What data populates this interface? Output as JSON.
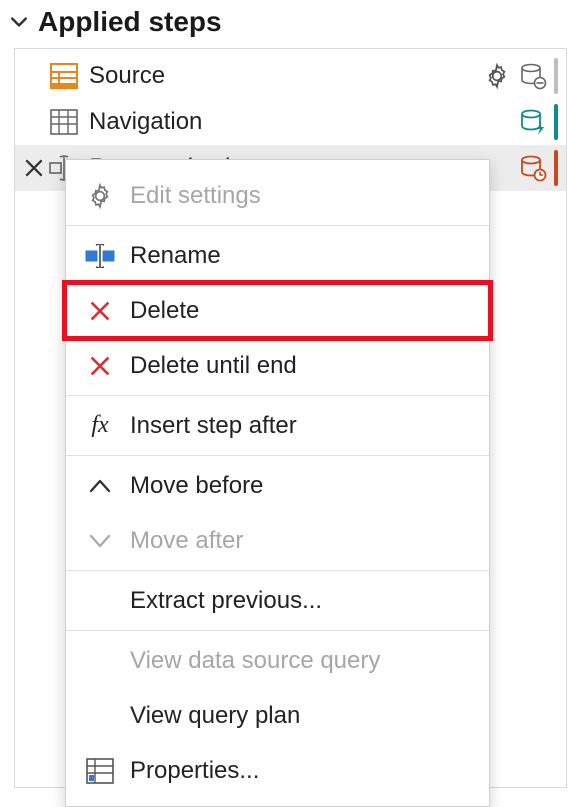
{
  "header": {
    "title": "Applied steps"
  },
  "steps": [
    {
      "label": "Source",
      "status": "grey"
    },
    {
      "label": "Navigation",
      "status": "teal"
    },
    {
      "label": "Renamed columns",
      "status": "orange"
    }
  ],
  "context_menu": {
    "items": [
      {
        "label": "Edit settings",
        "icon": "settings",
        "enabled": false
      },
      {
        "label": "Rename",
        "icon": "rename",
        "enabled": true
      },
      {
        "label": "Delete",
        "icon": "delete",
        "enabled": true,
        "highlighted": true
      },
      {
        "label": "Delete until end",
        "icon": "delete",
        "enabled": true
      },
      {
        "label": "Insert step after",
        "icon": "fx",
        "enabled": true
      },
      {
        "label": "Move before",
        "icon": "up",
        "enabled": true
      },
      {
        "label": "Move after",
        "icon": "down",
        "enabled": false
      },
      {
        "label": "Extract previous...",
        "icon": "none",
        "enabled": true
      },
      {
        "label": "View data source query",
        "icon": "none",
        "enabled": false
      },
      {
        "label": "View query plan",
        "icon": "none",
        "enabled": true
      },
      {
        "label": "Properties...",
        "icon": "properties",
        "enabled": true
      }
    ]
  }
}
